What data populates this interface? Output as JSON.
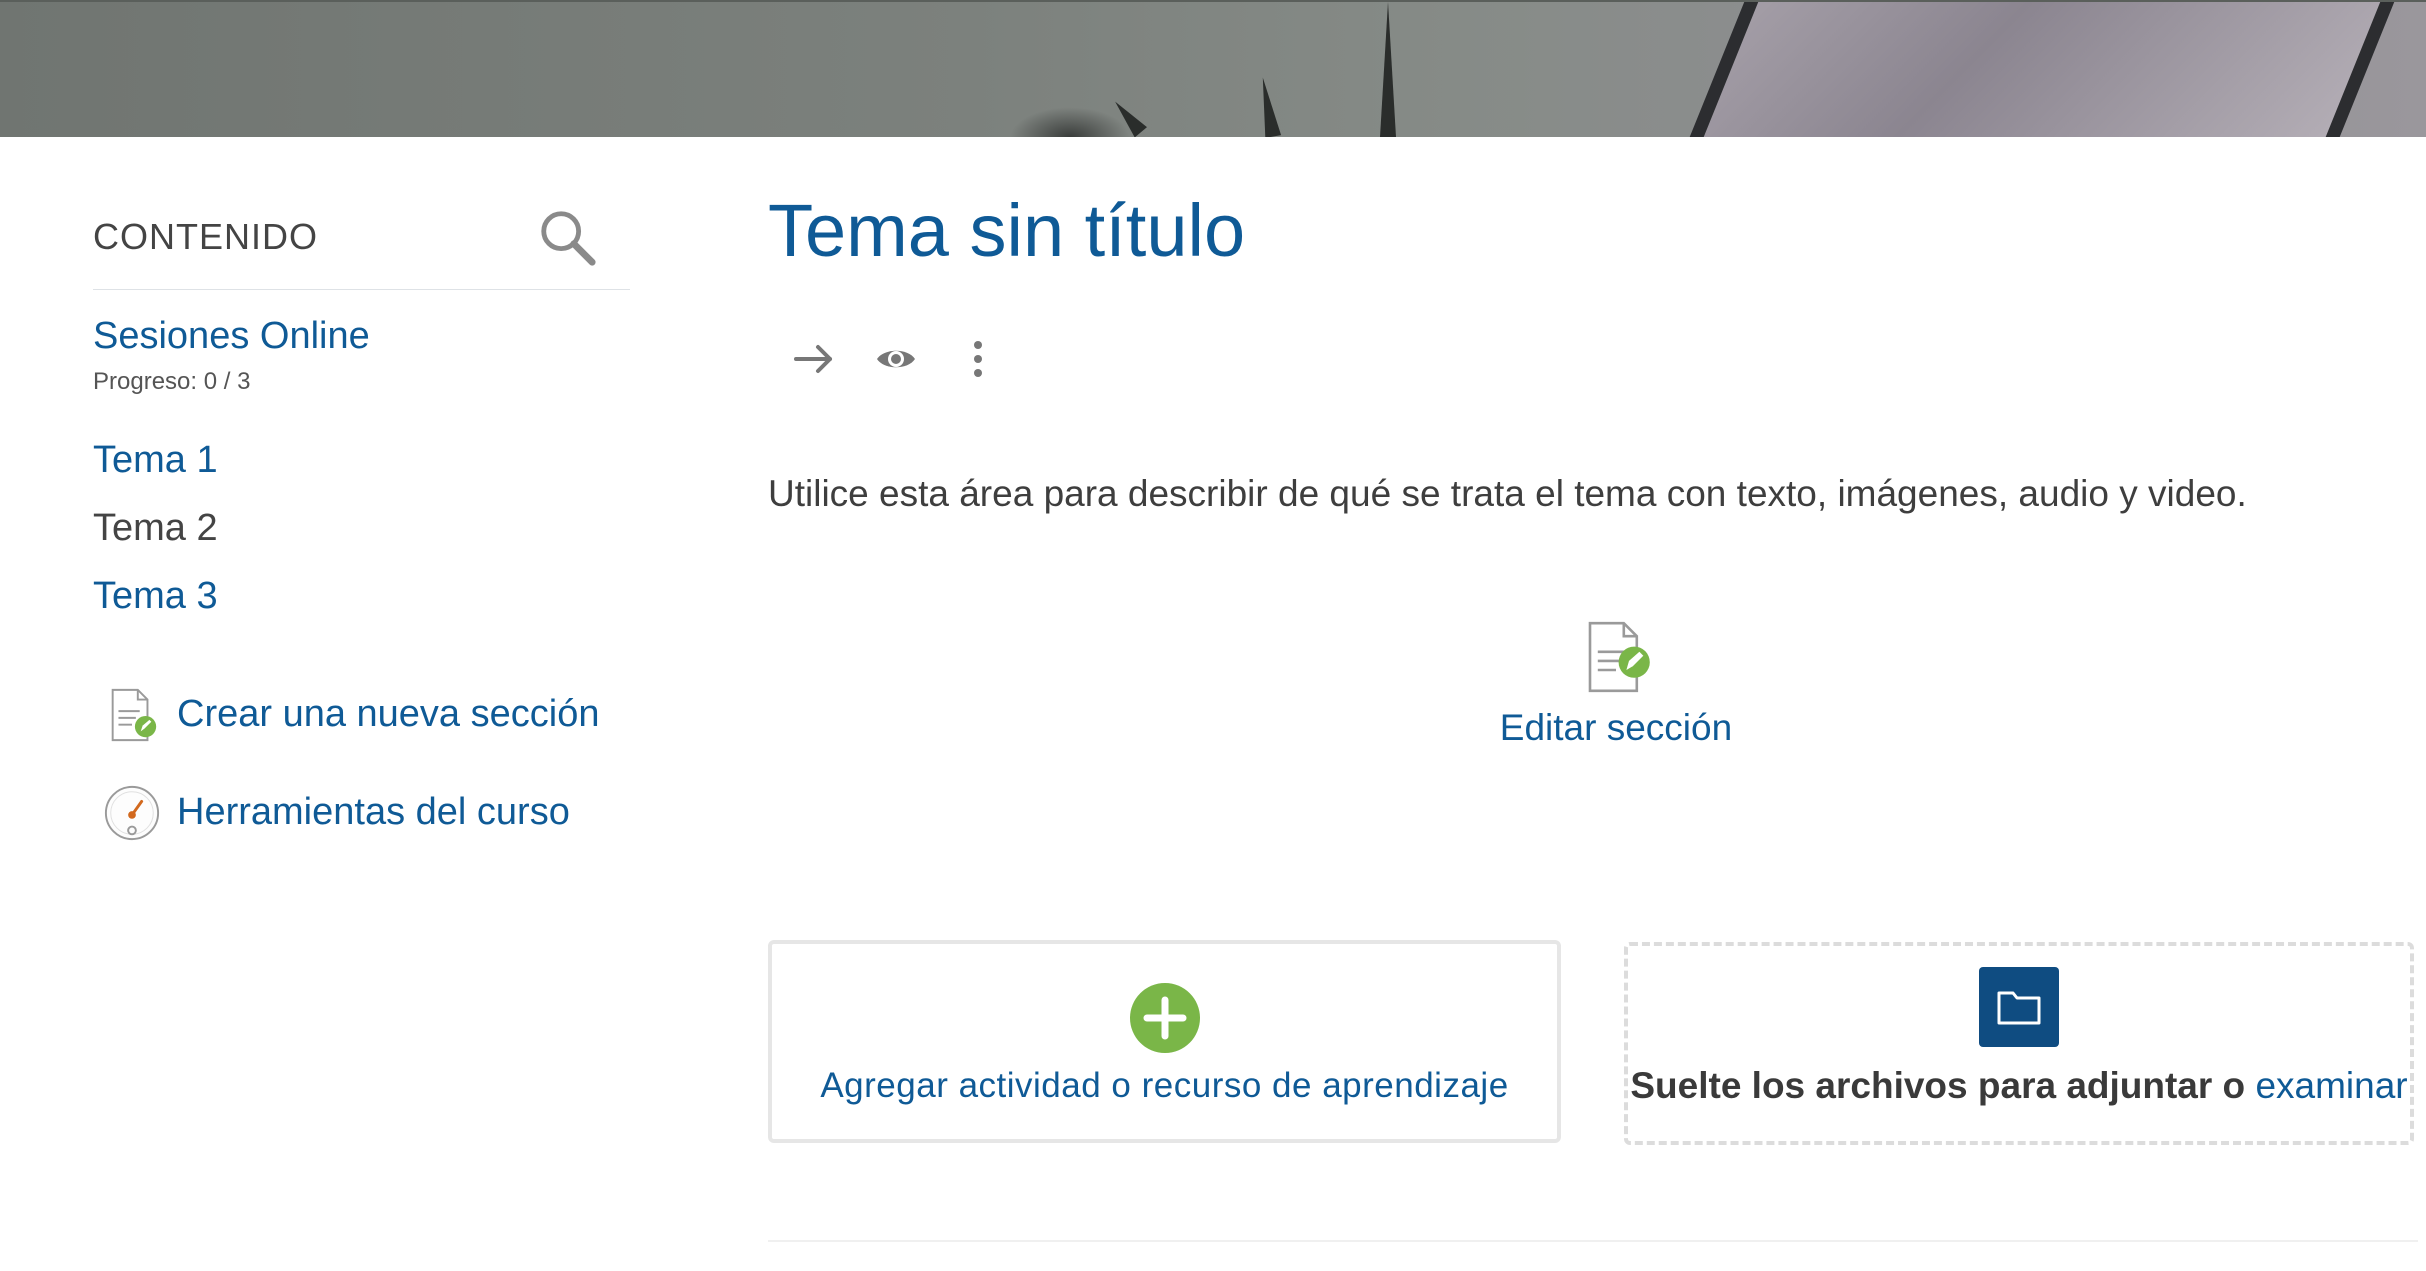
{
  "sidebar": {
    "title": "CONTENIDO",
    "section": {
      "name": "Sesiones Online",
      "progress": "Progreso: 0 / 3"
    },
    "items": [
      {
        "label": "Tema 1",
        "state": "link"
      },
      {
        "label": "Tema 2",
        "state": "current"
      },
      {
        "label": "Tema 3",
        "state": "link"
      }
    ],
    "tools": {
      "new_section": "Crear una nueva sección",
      "course_tools": "Herramientas del curso"
    }
  },
  "main": {
    "title": "Tema sin título",
    "summary": "Utilice esta área para describir de qué se trata el tema con texto, imágenes, audio y video.",
    "edit_section": "Editar sección",
    "add_activity": "Agregar actividad o recurso de aprendizaje",
    "dropzone": {
      "text": "Suelte los archivos para adjuntar o",
      "link": "examinar"
    }
  },
  "colors": {
    "link": "#0f5a96",
    "accent_green": "#7ab648",
    "folder_button": "#0f4c81"
  }
}
